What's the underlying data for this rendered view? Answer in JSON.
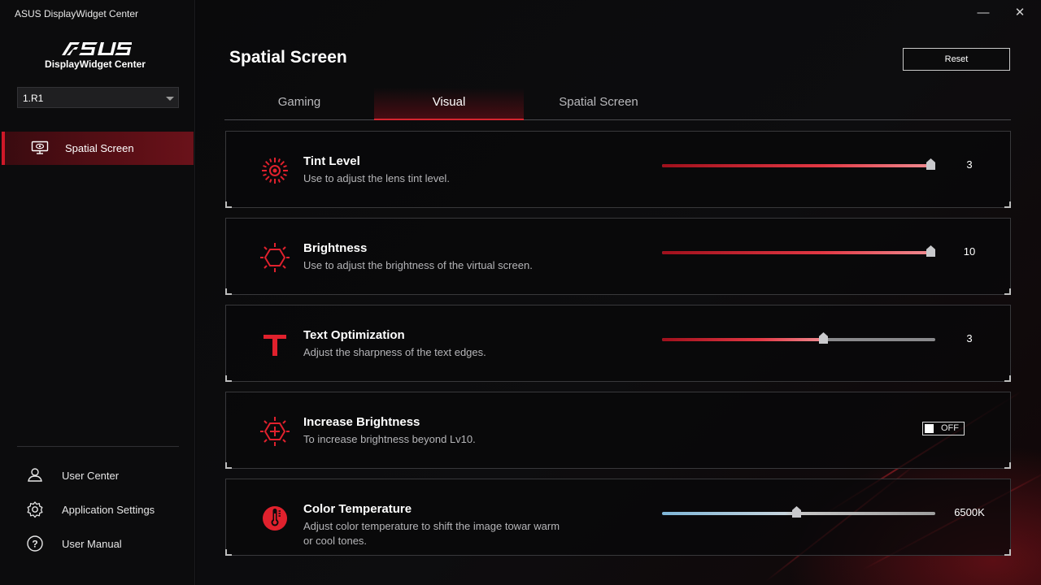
{
  "window": {
    "title": "ASUS DisplayWidget Center",
    "minimize_glyph": "—",
    "close_glyph": "✕"
  },
  "sidebar": {
    "logo_text": "ASUS",
    "app_name": "DisplayWidget Center",
    "monitor_select": {
      "value": "1.R1"
    },
    "nav": [
      {
        "label": "Spatial Screen",
        "icon": "monitor-eye-icon",
        "active": true
      }
    ],
    "bottom_links": [
      {
        "label": "User Center",
        "icon": "user-bell-icon"
      },
      {
        "label": "Application Settings",
        "icon": "gear-icon"
      },
      {
        "label": "User Manual",
        "icon": "question-circle-icon"
      }
    ]
  },
  "main": {
    "page_title": "Spatial Screen",
    "reset_label": "Reset",
    "tabs": [
      {
        "label": "Gaming",
        "active": false
      },
      {
        "label": "Visual",
        "active": true
      },
      {
        "label": "Spatial Screen",
        "active": false
      }
    ],
    "settings": [
      {
        "title": "Tint Level",
        "desc": "Use to adjust the lens tint level.",
        "icon": "tint-sun-icon",
        "control": "slider",
        "value": "3",
        "level": 1.0
      },
      {
        "title": "Brightness",
        "desc": "Use to adjust the brightness of the virtual screen.",
        "icon": "brightness-hexagon-icon",
        "control": "slider",
        "value": "10",
        "level": 1.0
      },
      {
        "title": "Text Optimization",
        "desc": "Adjust the sharpness of the text edges.",
        "icon": "text-t-icon",
        "control": "slider",
        "value": "3",
        "level": 0.6
      },
      {
        "title": "Increase Brightness",
        "desc": "To increase brightness beyond Lv10.",
        "icon": "brightness-plus-icon",
        "control": "toggle",
        "toggle_label": "OFF",
        "on": false
      },
      {
        "title": "Color Temperature",
        "desc": "Adjust color temperature to shift the image towar warm or cool tones.",
        "icon": "thermometer-icon",
        "control": "slider",
        "value": "6500K",
        "level": 0.5
      }
    ]
  },
  "colors": {
    "accent": "#d01828",
    "background": "#070708",
    "card_border": "#38383b"
  }
}
